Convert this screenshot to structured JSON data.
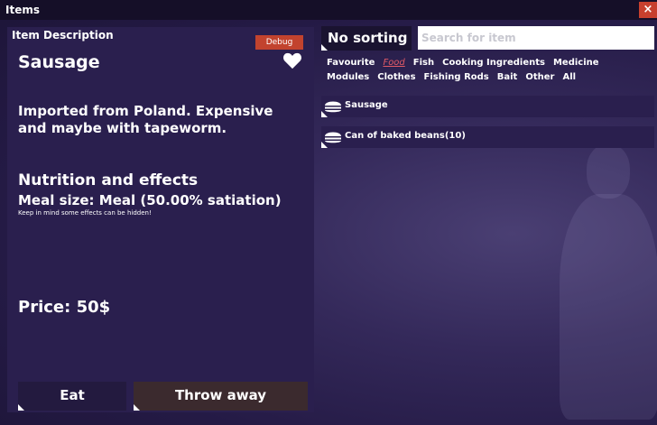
{
  "window": {
    "title": "Items",
    "close_label": "×"
  },
  "left_panel": {
    "header": "Item Description",
    "debug_tag": "Debug",
    "item_name": "Sausage",
    "description": "Imported from Poland. Expensive and maybe with tapeworm.",
    "nutrition_title": "Nutrition and effects",
    "meal_size": "Meal size: Meal (50.00% satiation)",
    "hint": "Keep in mind some effects can be hidden!",
    "price": "Price: 50$",
    "eat_label": "Eat",
    "throw_label": "Throw away"
  },
  "right_panel": {
    "sort_label": "No sorting",
    "search_placeholder": "Search for item",
    "filters": [
      "Favourite",
      "Food",
      "Fish",
      "Cooking Ingredients",
      "Medicine",
      "Modules",
      "Clothes",
      "Fishing Rods",
      "Bait",
      "Other",
      "All"
    ],
    "active_filter": "Food",
    "items": [
      {
        "label": "Sausage",
        "icon": "burger-icon"
      },
      {
        "label": "Can of baked beans(10)",
        "icon": "burger-icon"
      }
    ]
  },
  "colors": {
    "accent": "#c2432e",
    "active_filter": "#e05a66",
    "panel": "#2a1f4e"
  }
}
